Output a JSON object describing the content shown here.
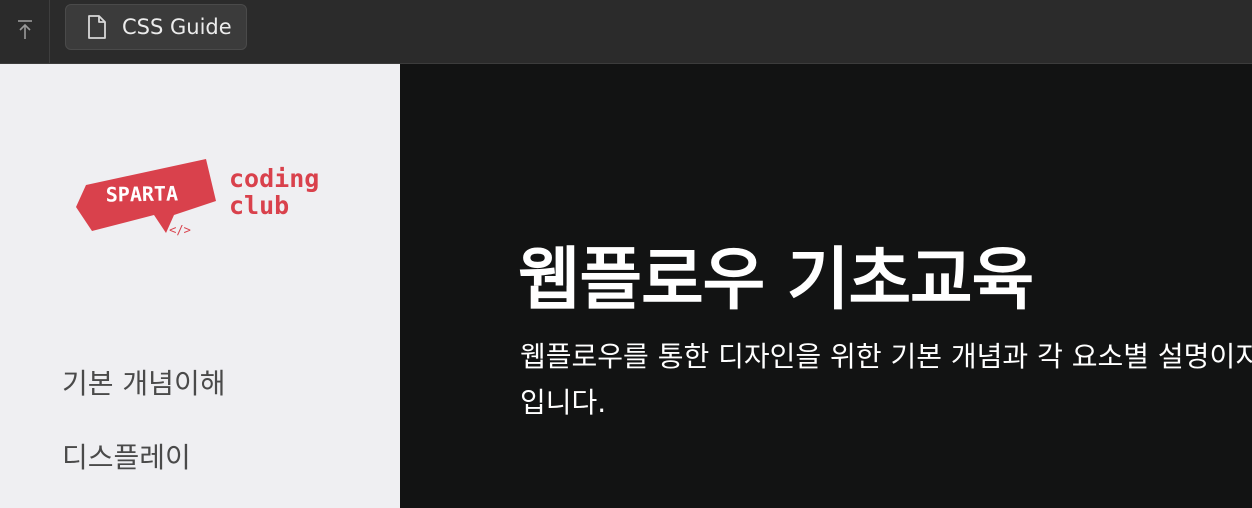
{
  "tab": {
    "label": "CSS Guide"
  },
  "logo": {
    "brand": "SPARTA",
    "line1": "coding",
    "line2": "club",
    "code_mark": "</>"
  },
  "nav": {
    "items": [
      {
        "label": "기본 개념이해"
      },
      {
        "label": "디스플레이"
      }
    ]
  },
  "hero": {
    "title": "웹플로우 기초교육",
    "description": "웹플로우를 통한 디자인을 위한 기본 개념과 각 요소별 설명이지 입니다."
  },
  "colors": {
    "brand_red": "#d9414c",
    "sidebar_bg": "#efeff2",
    "main_bg": "#121313",
    "topbar_bg": "#2b2b2b"
  },
  "icons": {
    "back": "arrow-up-bar-icon",
    "tab": "document-icon"
  }
}
